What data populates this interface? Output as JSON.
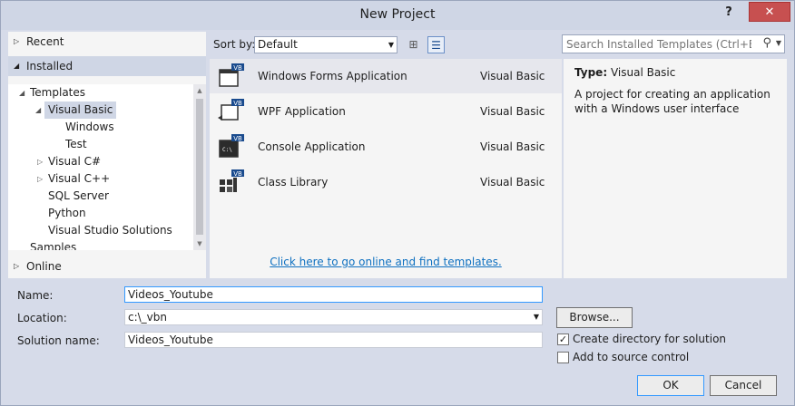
{
  "window": {
    "title": "New Project",
    "help_label": "?",
    "close_label": "✕"
  },
  "nav": {
    "recent": "Recent",
    "installed": "Installed",
    "online": "Online",
    "tree": [
      {
        "label": "Templates"
      },
      {
        "label": "Visual Basic"
      },
      {
        "label": "Windows"
      },
      {
        "label": "Test"
      },
      {
        "label": "Visual C#"
      },
      {
        "label": "Visual C++"
      },
      {
        "label": "SQL Server"
      },
      {
        "label": "Python"
      },
      {
        "label": "Visual Studio Solutions"
      },
      {
        "label": "Samples"
      }
    ]
  },
  "toolbar": {
    "sort_label": "Sort by:",
    "sort_value": "Default",
    "search_placeholder": "Search Installed Templates (Ctrl+E)"
  },
  "templates": [
    {
      "name": "Windows Forms Application",
      "language": "Visual Basic"
    },
    {
      "name": "WPF Application",
      "language": "Visual Basic"
    },
    {
      "name": "Console Application",
      "language": "Visual Basic"
    },
    {
      "name": "Class Library",
      "language": "Visual Basic"
    }
  ],
  "online_link": "Click here to go online and find templates.",
  "details": {
    "type_label": "Type:",
    "type_value": "Visual Basic",
    "description": "A project for creating an application with a Windows user interface"
  },
  "form": {
    "name_label": "Name:",
    "name_value": "Videos_Youtube",
    "location_label": "Location:",
    "location_value": "c:\\_vbn",
    "solution_label": "Solution name:",
    "solution_value": "Videos_Youtube",
    "browse_label": "Browse...",
    "create_dir_label": "Create directory for solution",
    "create_dir_checked": "✓",
    "source_control_label": "Add to source control",
    "ok_label": "OK",
    "cancel_label": "Cancel"
  },
  "icons": {
    "vb_badge": "VB",
    "colors": {
      "accent": "#3399ff",
      "link": "#0e70c0",
      "selection": "#cfd6e5"
    }
  }
}
